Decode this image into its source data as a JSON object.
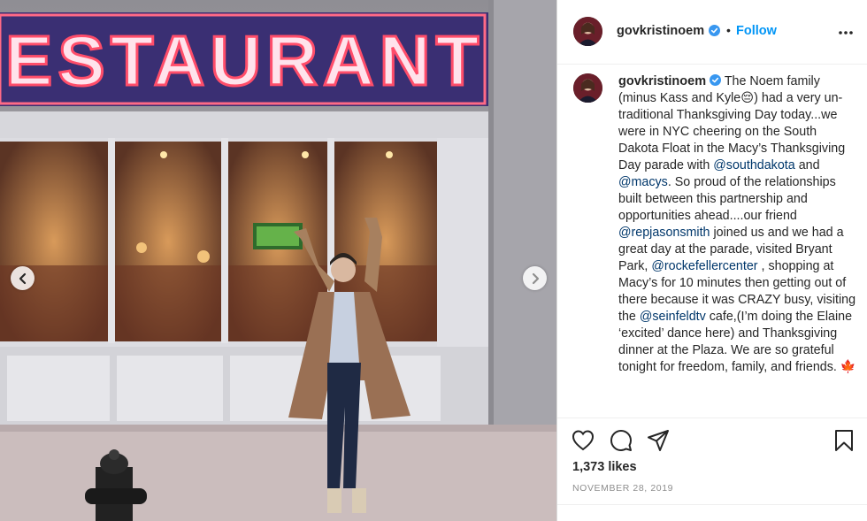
{
  "post": {
    "author": "govkristinoem",
    "follow_label": "Follow",
    "separator": "•",
    "sign_text": "ESTAURANT",
    "caption_intro": "The Noem family (minus Kass and Kyle😔) had a very un-traditional Thanksgiving Day today...we were in NYC cheering on the South Dakota Float in the Macy’s Thanksgiving Day parade with ",
    "mention_1": "@southdakota",
    "caption_and": " and ",
    "mention_2": "@macys",
    "caption_mid_1": ". So proud of the relationships built between this partnership and opportunities ahead....our friend ",
    "mention_3": "@repjasonsmith",
    "caption_mid_2": " joined us and we had a great day at the parade, visited Bryant Park, ",
    "mention_4": "@rockefellercenter",
    "caption_mid_3": " , shopping at Macy’s for 10 minutes then getting out of there because it was CRAZY busy, visiting the ",
    "mention_5": "@seinfeldtv",
    "caption_end": " cafe,(I’m doing the Elaine ‘excited’ dance here) and Thanksgiving dinner at the Plaza. We are so grateful tonight for freedom, family, and friends. 🍁",
    "likes": "1,373 likes",
    "date": "November 28, 2019"
  },
  "icons": {
    "verified": "verified-badge-icon",
    "more": "more-options-icon",
    "like": "heart-icon",
    "comment": "comment-icon",
    "share": "share-icon",
    "save": "bookmark-icon",
    "prev": "chevron-left-icon",
    "next": "chevron-right-icon"
  },
  "colors": {
    "link_blue": "#0095f6",
    "mention": "#00376b",
    "verified": "#3897f0",
    "neon_sign": "#ff4d6a"
  }
}
